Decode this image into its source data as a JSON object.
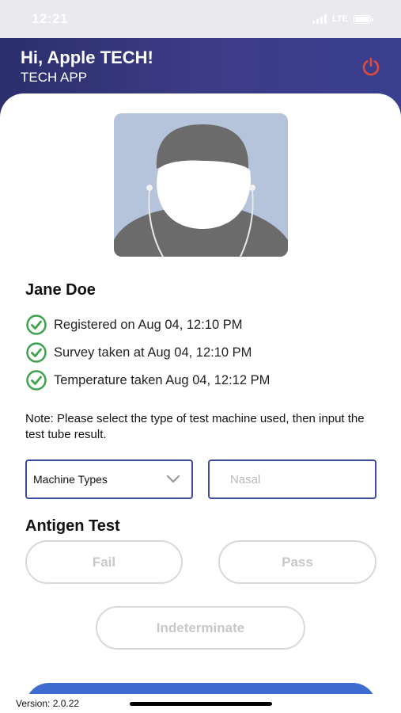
{
  "status_bar": {
    "time": "12:21",
    "network": "LTE"
  },
  "header": {
    "greeting": "Hi, Apple TECH!",
    "subtitle": "TECH APP",
    "power_icon": "power-icon",
    "power_color": "#e24a3b"
  },
  "profile": {
    "avatar_icon": "person-placeholder",
    "avatar_bg": "#b5c3db",
    "name": "Jane Doe"
  },
  "checklist": [
    {
      "icon": "check-circle-icon",
      "text": "Registered on Aug 04, 12:10 PM"
    },
    {
      "icon": "check-circle-icon",
      "text": "Survey taken at Aug 04, 12:10 PM"
    },
    {
      "icon": "check-circle-icon",
      "text": "Temperature taken Aug 04, 12:12 PM"
    }
  ],
  "check_color": "#3fa34d",
  "note": "Note: Please select the type of test machine used, then input the test tube result.",
  "machine_select": {
    "value": "Machine Types",
    "icon": "chevron-down-icon"
  },
  "sample_input": {
    "placeholder": "Nasal",
    "value": ""
  },
  "antigen_test": {
    "title": "Antigen Test",
    "options": [
      "Fail",
      "Pass",
      "Indeterminate"
    ]
  },
  "accent_color": "#3e4a9c",
  "primary_button_color": "#3f6cd0",
  "footer": {
    "version": "Version: 2.0.22"
  }
}
